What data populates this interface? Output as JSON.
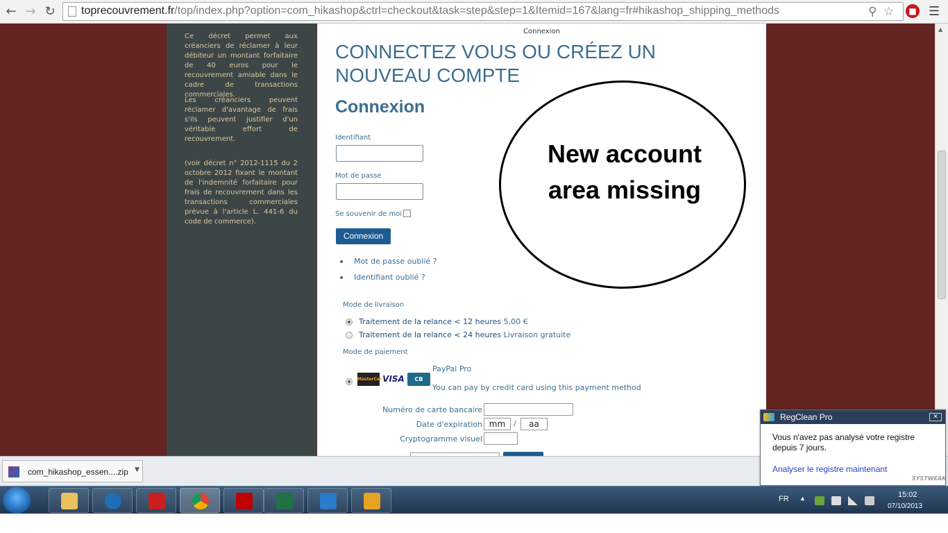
{
  "browser": {
    "url_domain": "toprecouvrement.fr",
    "url_path": "/top/index.php?option=com_hikashop&ctrl=checkout&task=step&step=1&Itemid=167&lang=fr#hikashop_shipping_methods"
  },
  "sidebar": {
    "para1": "Ce décret permet aux créanciers de réclamer à leur débiteur un montant forfaitaire de 40 euros pour le recouvrement amiable dans le cadre de transactions commerciales.",
    "para2": "Les créanciers peuvent réclamer d'avantage de frais s'ils peuvent justifier d'un véritable effort de recouvrement.",
    "para3": "(voir décret n° 2012-1115 du 2 octobre 2012 fixant le montant de l'indemnité forfaitaire pour frais de recouvrement dans les transactions commerciales prévue à l'article L. 441-6 du code de commerce)."
  },
  "main": {
    "breadcrumb": "Connexion",
    "title": "CONNECTEZ VOUS OU CRÉEZ UN NOUVEAU COMPTE",
    "subtitle": "Connexion",
    "login": {
      "username_label": "Identifiant",
      "password_label": "Mot de passe",
      "remember_label": "Se souvenir de moi",
      "submit_label": "Connexion",
      "forgot_password": "Mot de passe oublié ?",
      "forgot_username": "Identifiant oublié ?"
    },
    "shipping": {
      "heading": "Mode de livraison",
      "options": [
        {
          "name": "Traitement de la relance < 12 heures",
          "price": "5,00 €",
          "selected": true
        },
        {
          "name": "Traitement de la relance < 24 heures",
          "price": "Livraison gratuite",
          "selected": false
        }
      ]
    },
    "payment": {
      "heading": "Mode de paiement",
      "method_name": "PayPal Pro",
      "method_desc": "You can pay by credit card using this payment method",
      "cards": [
        "MasterCard",
        "VISA",
        "CB"
      ],
      "card_number_label": "Numéro de carte bancaire",
      "expiry_label": "Date d'expiration",
      "expiry_month_placeholder": "mm",
      "expiry_separator": "/",
      "expiry_year_placeholder": "aa",
      "cvv_label": "Cryptogramme visuel"
    },
    "annotation": {
      "line1": "New account",
      "line2": "area missing"
    }
  },
  "download": {
    "file_name": "com_hikashop_essen....zip"
  },
  "notification": {
    "title": "RegClean Pro",
    "message": "Vous n'avez pas analysé votre registre depuis 7 jours.",
    "link": "Analyser le registre maintenant",
    "brand": "SYSTWEAK"
  },
  "taskbar": {
    "language": "FR",
    "time": "15:02",
    "date": "07/10/2013",
    "apps": [
      "explorer",
      "hp",
      "acrobat",
      "chrome",
      "filezilla",
      "excel",
      "app7",
      "outlook"
    ]
  },
  "colors": {
    "accent_blue": "#3b6e8f",
    "button_blue": "#1e5b93",
    "sidebar_bg": "#3d4646",
    "page_bg": "#642421"
  }
}
